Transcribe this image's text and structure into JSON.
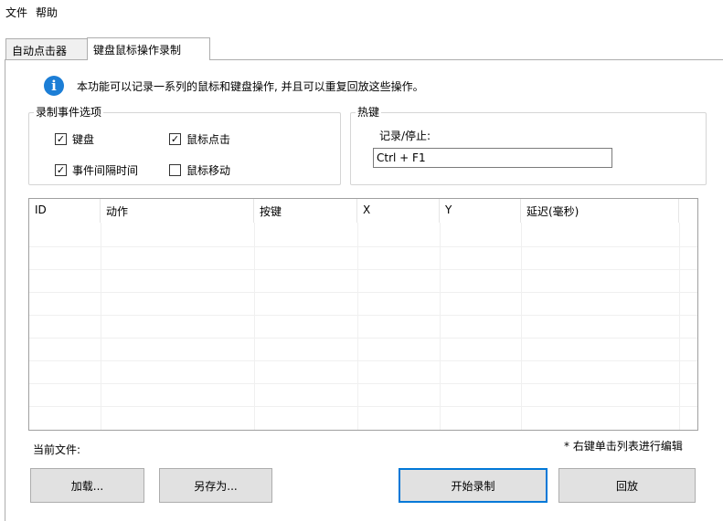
{
  "menu": {
    "file": "文件",
    "help": "帮助"
  },
  "tabs": [
    {
      "label": "自动点击器",
      "active": false
    },
    {
      "label": "键盘鼠标操作录制",
      "active": true
    }
  ],
  "info": {
    "icon": "info-icon",
    "icon_glyph": "i",
    "text": "本功能可以记录一系列的鼠标和键盘操作, 并且可以重复回放这些操作。"
  },
  "record_options": {
    "title": "录制事件选项",
    "keyboard": {
      "label": "键盘",
      "checked": true
    },
    "mouse_click": {
      "label": "鼠标点击",
      "checked": true
    },
    "event_interval": {
      "label": "事件间隔时间",
      "checked": true
    },
    "mouse_move": {
      "label": "鼠标移动",
      "checked": false
    }
  },
  "hotkey": {
    "title": "热键",
    "record_stop_label": "记录/停止:",
    "value": "Ctrl + F1"
  },
  "table": {
    "columns": [
      "ID",
      "动作",
      "按键",
      "X",
      "Y",
      "延迟(毫秒)"
    ],
    "rows": []
  },
  "current_file_label": "当前文件:",
  "hint": "* 右键单击列表进行编辑",
  "buttons": {
    "load": "加载...",
    "save_as": "另存为...",
    "start_record": "开始录制",
    "playback": "回放"
  },
  "colors": {
    "accent": "#0078d7",
    "info": "#1c7ed6"
  }
}
